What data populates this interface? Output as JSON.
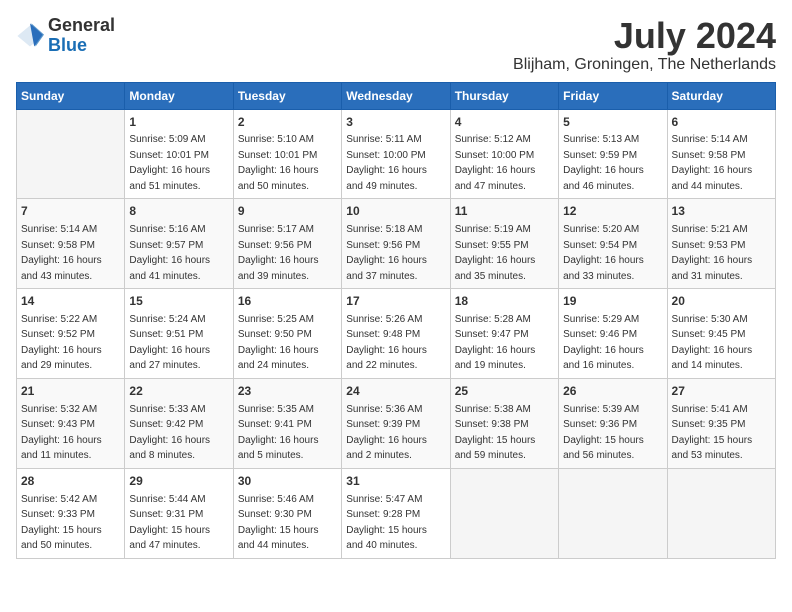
{
  "header": {
    "logo_general": "General",
    "logo_blue": "Blue",
    "month_title": "July 2024",
    "location": "Blijham, Groningen, The Netherlands"
  },
  "calendar": {
    "days_of_week": [
      "Sunday",
      "Monday",
      "Tuesday",
      "Wednesday",
      "Thursday",
      "Friday",
      "Saturday"
    ],
    "weeks": [
      [
        {
          "day": "",
          "info": ""
        },
        {
          "day": "1",
          "info": "Sunrise: 5:09 AM\nSunset: 10:01 PM\nDaylight: 16 hours\nand 51 minutes."
        },
        {
          "day": "2",
          "info": "Sunrise: 5:10 AM\nSunset: 10:01 PM\nDaylight: 16 hours\nand 50 minutes."
        },
        {
          "day": "3",
          "info": "Sunrise: 5:11 AM\nSunset: 10:00 PM\nDaylight: 16 hours\nand 49 minutes."
        },
        {
          "day": "4",
          "info": "Sunrise: 5:12 AM\nSunset: 10:00 PM\nDaylight: 16 hours\nand 47 minutes."
        },
        {
          "day": "5",
          "info": "Sunrise: 5:13 AM\nSunset: 9:59 PM\nDaylight: 16 hours\nand 46 minutes."
        },
        {
          "day": "6",
          "info": "Sunrise: 5:14 AM\nSunset: 9:58 PM\nDaylight: 16 hours\nand 44 minutes."
        }
      ],
      [
        {
          "day": "7",
          "info": "Sunrise: 5:14 AM\nSunset: 9:58 PM\nDaylight: 16 hours\nand 43 minutes."
        },
        {
          "day": "8",
          "info": "Sunrise: 5:16 AM\nSunset: 9:57 PM\nDaylight: 16 hours\nand 41 minutes."
        },
        {
          "day": "9",
          "info": "Sunrise: 5:17 AM\nSunset: 9:56 PM\nDaylight: 16 hours\nand 39 minutes."
        },
        {
          "day": "10",
          "info": "Sunrise: 5:18 AM\nSunset: 9:56 PM\nDaylight: 16 hours\nand 37 minutes."
        },
        {
          "day": "11",
          "info": "Sunrise: 5:19 AM\nSunset: 9:55 PM\nDaylight: 16 hours\nand 35 minutes."
        },
        {
          "day": "12",
          "info": "Sunrise: 5:20 AM\nSunset: 9:54 PM\nDaylight: 16 hours\nand 33 minutes."
        },
        {
          "day": "13",
          "info": "Sunrise: 5:21 AM\nSunset: 9:53 PM\nDaylight: 16 hours\nand 31 minutes."
        }
      ],
      [
        {
          "day": "14",
          "info": "Sunrise: 5:22 AM\nSunset: 9:52 PM\nDaylight: 16 hours\nand 29 minutes."
        },
        {
          "day": "15",
          "info": "Sunrise: 5:24 AM\nSunset: 9:51 PM\nDaylight: 16 hours\nand 27 minutes."
        },
        {
          "day": "16",
          "info": "Sunrise: 5:25 AM\nSunset: 9:50 PM\nDaylight: 16 hours\nand 24 minutes."
        },
        {
          "day": "17",
          "info": "Sunrise: 5:26 AM\nSunset: 9:48 PM\nDaylight: 16 hours\nand 22 minutes."
        },
        {
          "day": "18",
          "info": "Sunrise: 5:28 AM\nSunset: 9:47 PM\nDaylight: 16 hours\nand 19 minutes."
        },
        {
          "day": "19",
          "info": "Sunrise: 5:29 AM\nSunset: 9:46 PM\nDaylight: 16 hours\nand 16 minutes."
        },
        {
          "day": "20",
          "info": "Sunrise: 5:30 AM\nSunset: 9:45 PM\nDaylight: 16 hours\nand 14 minutes."
        }
      ],
      [
        {
          "day": "21",
          "info": "Sunrise: 5:32 AM\nSunset: 9:43 PM\nDaylight: 16 hours\nand 11 minutes."
        },
        {
          "day": "22",
          "info": "Sunrise: 5:33 AM\nSunset: 9:42 PM\nDaylight: 16 hours\nand 8 minutes."
        },
        {
          "day": "23",
          "info": "Sunrise: 5:35 AM\nSunset: 9:41 PM\nDaylight: 16 hours\nand 5 minutes."
        },
        {
          "day": "24",
          "info": "Sunrise: 5:36 AM\nSunset: 9:39 PM\nDaylight: 16 hours\nand 2 minutes."
        },
        {
          "day": "25",
          "info": "Sunrise: 5:38 AM\nSunset: 9:38 PM\nDaylight: 15 hours\nand 59 minutes."
        },
        {
          "day": "26",
          "info": "Sunrise: 5:39 AM\nSunset: 9:36 PM\nDaylight: 15 hours\nand 56 minutes."
        },
        {
          "day": "27",
          "info": "Sunrise: 5:41 AM\nSunset: 9:35 PM\nDaylight: 15 hours\nand 53 minutes."
        }
      ],
      [
        {
          "day": "28",
          "info": "Sunrise: 5:42 AM\nSunset: 9:33 PM\nDaylight: 15 hours\nand 50 minutes."
        },
        {
          "day": "29",
          "info": "Sunrise: 5:44 AM\nSunset: 9:31 PM\nDaylight: 15 hours\nand 47 minutes."
        },
        {
          "day": "30",
          "info": "Sunrise: 5:46 AM\nSunset: 9:30 PM\nDaylight: 15 hours\nand 44 minutes."
        },
        {
          "day": "31",
          "info": "Sunrise: 5:47 AM\nSunset: 9:28 PM\nDaylight: 15 hours\nand 40 minutes."
        },
        {
          "day": "",
          "info": ""
        },
        {
          "day": "",
          "info": ""
        },
        {
          "day": "",
          "info": ""
        }
      ]
    ]
  }
}
